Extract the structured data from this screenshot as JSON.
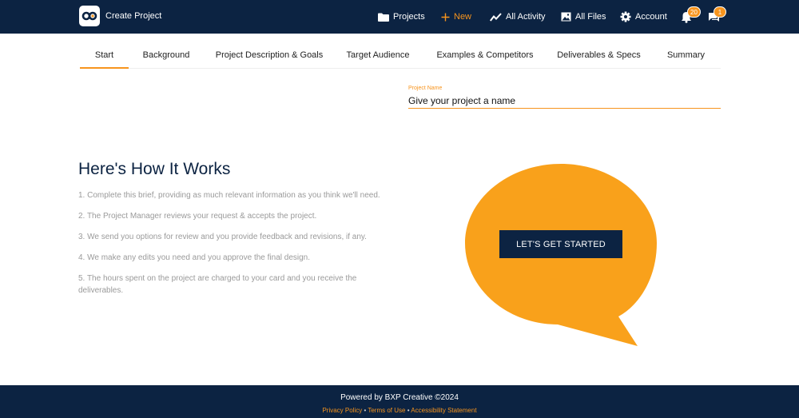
{
  "header": {
    "title": "Create Project",
    "nav": {
      "projects": "Projects",
      "new": "New",
      "activity": "All Activity",
      "files": "All Files",
      "account": "Account"
    },
    "notifications_count": "20",
    "messages_count": "1"
  },
  "tabs": [
    {
      "label": "Start"
    },
    {
      "label": "Background"
    },
    {
      "label": "Project Description & Goals"
    },
    {
      "label": "Target Audience"
    },
    {
      "label": "Examples & Competitors"
    },
    {
      "label": "Deliverables & Specs"
    },
    {
      "label": "Summary"
    }
  ],
  "project_name": {
    "label": "Project Name",
    "placeholder": "Give your project a name"
  },
  "how_it_works": {
    "title": "Here's How It Works",
    "steps": [
      "1. Complete this brief, providing as much relevant information as you think we'll need.",
      "2. The Project Manager reviews your request & accepts the project.",
      "3. We send you options for review and you provide feedback and revisions, if any.",
      "4. We make any edits you need and you approve the final design.",
      "5. The hours spent on the project are charged to your card and you receive the deliverables."
    ]
  },
  "cta": {
    "label": "LET'S GET STARTED"
  },
  "footer": {
    "powered_by": "Powered by BXP Creative ©2024",
    "links": {
      "privacy": "Privacy Policy",
      "terms": "Terms of Use",
      "accessibility": "Accessibility Statement"
    },
    "separator": " • "
  },
  "colors": {
    "navy": "#0c2342",
    "accent": "#f7941d"
  }
}
